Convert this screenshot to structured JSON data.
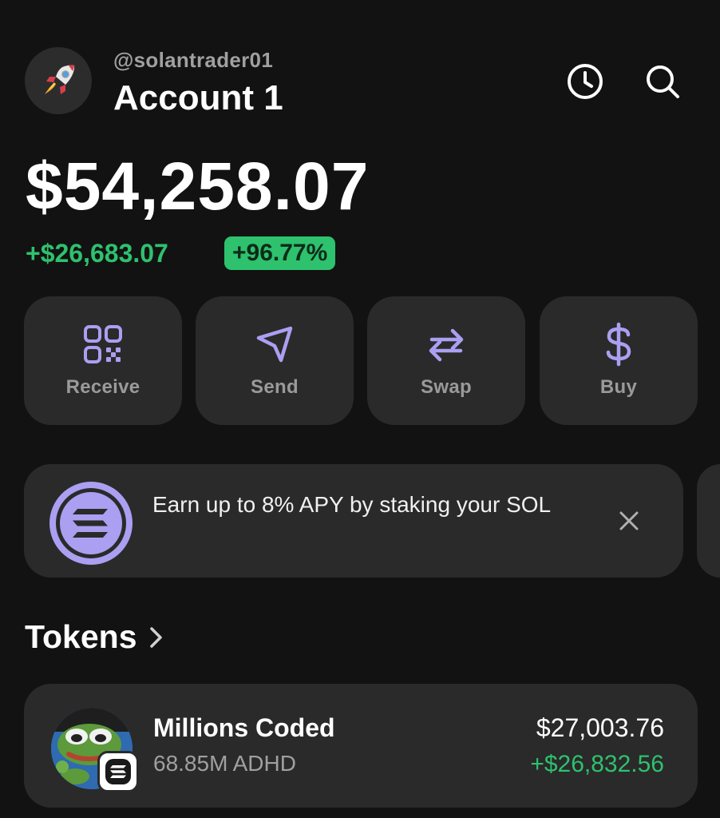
{
  "header": {
    "handle": "@solantrader01",
    "account_name": "Account 1",
    "avatar_icon": "rocket-icon",
    "history_icon": "clock-icon",
    "search_icon": "search-icon"
  },
  "balance": {
    "total": "$54,258.07",
    "change_amount": "+$26,683.07",
    "change_percent": "+96.77%"
  },
  "actions": [
    {
      "label": "Receive",
      "icon": "qr-code-icon"
    },
    {
      "label": "Send",
      "icon": "send-icon"
    },
    {
      "label": "Swap",
      "icon": "swap-icon"
    },
    {
      "label": "Buy",
      "icon": "dollar-icon"
    }
  ],
  "promo": {
    "text": "Earn up to 8% APY by staking your SOL",
    "icon": "solana-icon",
    "close_icon": "close-icon"
  },
  "tokens": {
    "title": "Tokens",
    "items": [
      {
        "name": "Millions Coded",
        "amount": "68.85M ADHD",
        "value": "$27,003.76",
        "change": "+$26,832.56"
      }
    ]
  },
  "colors": {
    "background": "#121212",
    "card": "#2a2a2a",
    "accent": "#ab9ff2",
    "positive": "#2ec16e"
  }
}
